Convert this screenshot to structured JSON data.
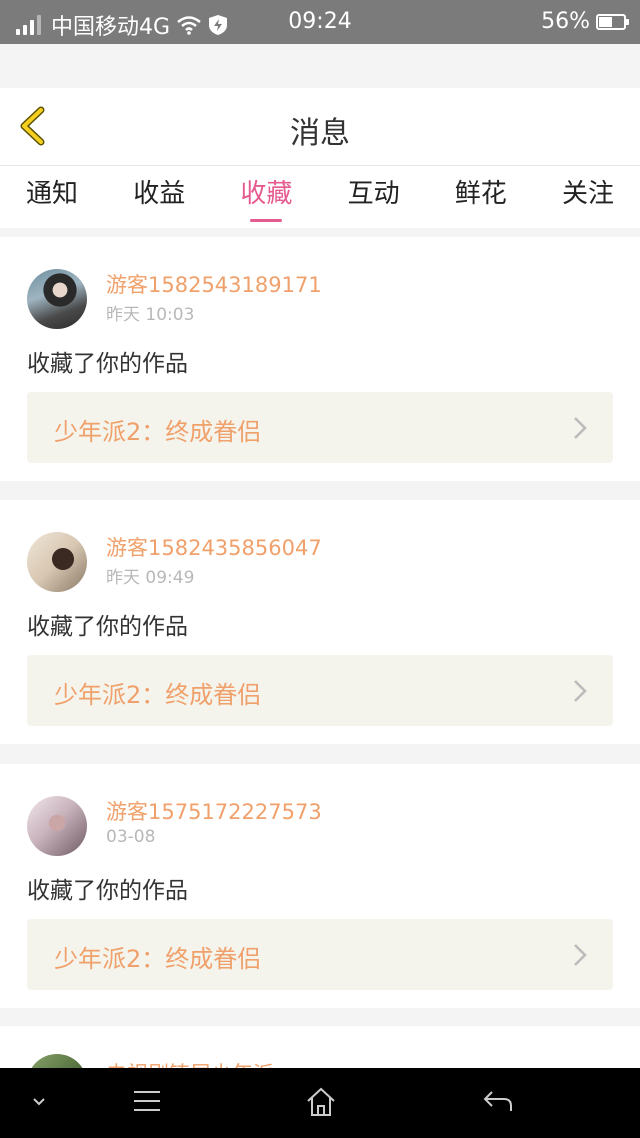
{
  "status_bar": {
    "carrier": "中国移动4G",
    "time": "09:24",
    "battery": "56%",
    "battery_level": 0.56,
    "icons": [
      "signal-icon",
      "wifi-icon",
      "shield-icon",
      "battery-icon"
    ]
  },
  "header": {
    "title": "消息",
    "back_icon": "chevron-left-icon"
  },
  "tabs": [
    {
      "label": "通知",
      "active": false
    },
    {
      "label": "收益",
      "active": false
    },
    {
      "label": "收藏",
      "active": true
    },
    {
      "label": "互动",
      "active": false
    },
    {
      "label": "鲜花",
      "active": false
    },
    {
      "label": "关注",
      "active": false
    }
  ],
  "messages": [
    {
      "user": "游客1582543189171",
      "time": "昨天 10:03",
      "action": "收藏了你的作品",
      "work": "少年派2：终成眷侣"
    },
    {
      "user": "游客1582435856047",
      "time": "昨天 09:49",
      "action": "收藏了你的作品",
      "work": "少年派2：终成眷侣"
    },
    {
      "user": "游客1575172227573",
      "time": "03-08",
      "action": "收藏了你的作品",
      "work": "少年派2：终成眷侣"
    }
  ],
  "partial_message": {
    "user": "电视剧铸屋少年派"
  },
  "colors": {
    "accent": "#e55b8f",
    "username": "#f0a06a",
    "work_bg": "#f5f4ec",
    "back_arrow": "#f5d020"
  },
  "nav_bar": {
    "icons": [
      "chevron-down-icon",
      "menu-icon",
      "home-icon",
      "back-icon"
    ]
  }
}
